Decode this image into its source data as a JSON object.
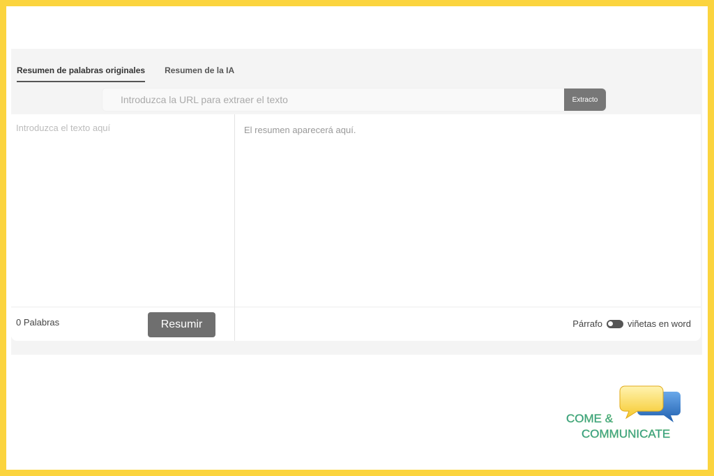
{
  "tabs": [
    {
      "label": "Resumen de palabras originales",
      "active": true
    },
    {
      "label": "Resumen de la IA",
      "active": false
    }
  ],
  "url_bar": {
    "placeholder": "Introduzca la URL para extraer el texto",
    "value": "",
    "extract_label": "Extracto"
  },
  "source": {
    "placeholder": "Introduzca el texto aquí",
    "value": "",
    "word_count": "0 Palabras",
    "summarize_label": "Resumir"
  },
  "summary": {
    "placeholder": "El resumen aparecerá aquí.",
    "mode_left": "Párrafo",
    "mode_right": "viñetas en word"
  },
  "logo": {
    "line1": "COME &",
    "line2": "COMMUNICATE"
  },
  "colors": {
    "frame": "#fbd43e",
    "button": "#6f6f6f",
    "logo_text": "#1b8a95",
    "logo_outline": "#7ec97b",
    "bubble_yellow": "#f6c92c",
    "bubble_blue": "#2a74c6"
  }
}
